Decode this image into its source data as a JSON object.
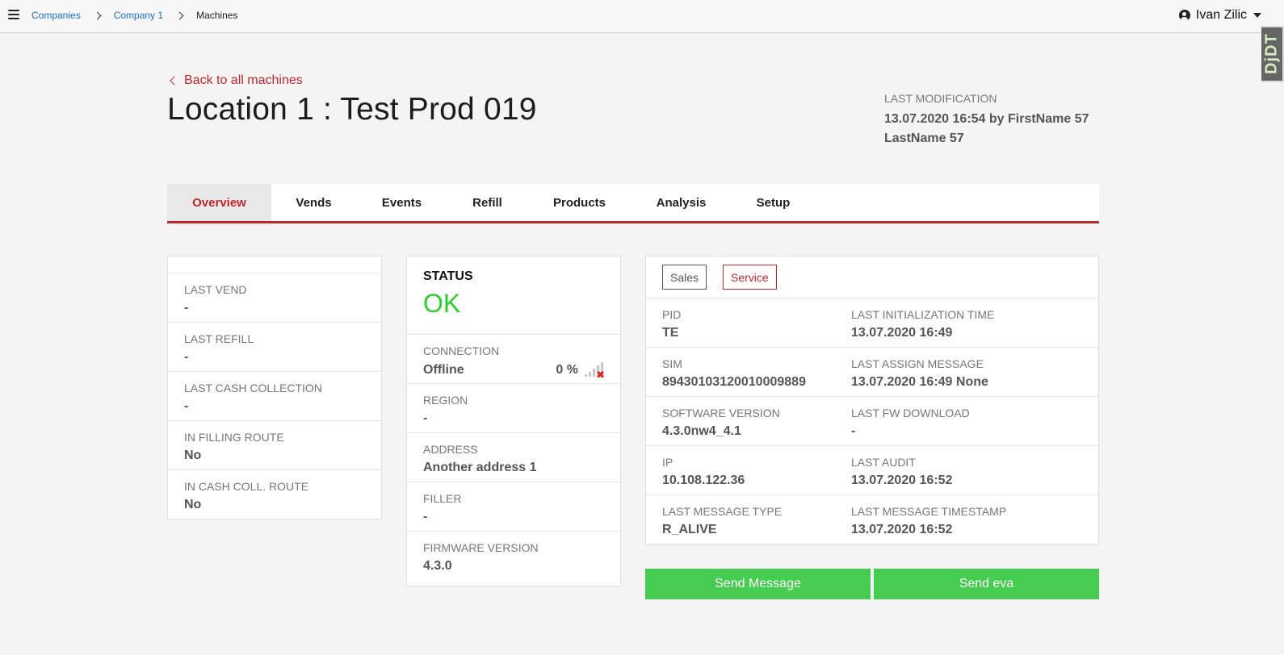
{
  "topbar": {
    "breadcrumbs": [
      "Companies",
      "Company 1"
    ],
    "current": "Machines",
    "user_name": "Ivan Zilic"
  },
  "debug_badge": "DjDT",
  "header": {
    "back_label": "Back to all machines",
    "title": "Location 1 : Test Prod 019",
    "last_modification_label": "LAST MODIFICATION",
    "last_modification_value": "13.07.2020 16:54 by FirstName 57 LastName 57"
  },
  "tabs": [
    {
      "label": "Overview",
      "active": true
    },
    {
      "label": "Vends"
    },
    {
      "label": "Events"
    },
    {
      "label": "Refill"
    },
    {
      "label": "Products"
    },
    {
      "label": "Analysis"
    },
    {
      "label": "Setup"
    }
  ],
  "left_card": [
    {
      "label": "LAST VEND",
      "value": "-"
    },
    {
      "label": "LAST REFILL",
      "value": "-"
    },
    {
      "label": "LAST CASH COLLECTION",
      "value": "-"
    },
    {
      "label": "IN FILLING ROUTE",
      "value": "No"
    },
    {
      "label": "IN CASH COLL. ROUTE",
      "value": "No"
    }
  ],
  "status_card": {
    "status_label": "STATUS",
    "status_value": "OK",
    "connection_label": "CONNECTION",
    "connection_value": "Offline",
    "signal_percent": "0 %",
    "region_label": "REGION",
    "region_value": "-",
    "address_label": "ADDRESS",
    "address_value": "Another address 1",
    "filler_label": "FILLER",
    "filler_value": "-",
    "firmware_label": "FIRMWARE VERSION",
    "firmware_value": "4.3.0"
  },
  "right_card": {
    "sales_label": "Sales",
    "service_label": "Service",
    "rows": [
      {
        "l_label": "PID",
        "l_value": "TE",
        "r_label": "LAST INITIALIZATION TIME",
        "r_value": "13.07.2020 16:49"
      },
      {
        "l_label": "SIM",
        "l_value": "8943010312001000988​9",
        "r_label": "LAST ASSIGN MESSAGE",
        "r_value": "13.07.2020 16:49 None"
      },
      {
        "l_label": "SOFTWARE VERSION",
        "l_value": "4.3.0nw4_4.1",
        "r_label": "LAST FW DOWNLOAD",
        "r_value": "-"
      },
      {
        "l_label": "IP",
        "l_value": "10.108.122.36",
        "r_label": "LAST AUDIT",
        "r_value": "13.07.2020 16:52"
      },
      {
        "l_label": "LAST MESSAGE TYPE",
        "l_value": "R_ALIVE",
        "r_label": "LAST MESSAGE TIMESTAMP",
        "r_value": "13.07.2020 16:52"
      }
    ]
  },
  "actions": {
    "send_message": "Send Message",
    "send_eva": "Send eva"
  },
  "colors": {
    "accent": "#c0262d",
    "status_ok": "#2ecc2e",
    "action_green": "#47cc52",
    "link_blue": "#1a73c8"
  }
}
